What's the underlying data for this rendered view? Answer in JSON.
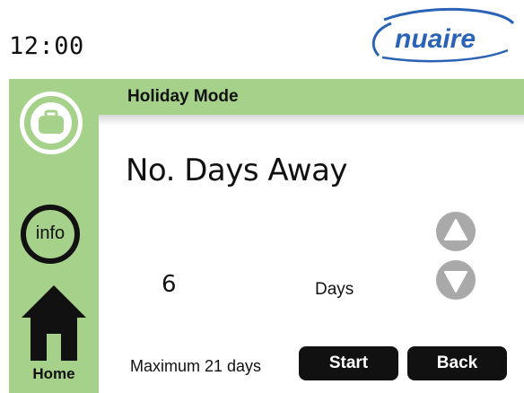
{
  "status_bar": {
    "time": "12:00",
    "logo_text": "nuaire"
  },
  "sidebar": {
    "items": [
      {
        "label": "",
        "icon": "suitcase-icon",
        "active": true
      },
      {
        "label": "info",
        "icon": "info-icon"
      },
      {
        "label": "Home",
        "icon": "home-icon"
      }
    ]
  },
  "header": {
    "title": "Holiday Mode"
  },
  "main": {
    "heading": "No. Days Away",
    "days_value": "6",
    "days_unit": "Days",
    "max_note": "Maximum 21 days",
    "increase_icon": "triangle-up-icon",
    "decrease_icon": "triangle-down-icon"
  },
  "actions": {
    "start_label": "Start",
    "back_label": "Back"
  },
  "colors": {
    "accent_green": "#a5d18a",
    "button_black": "#111111",
    "arrow_gray": "#a9a9a9",
    "logo_blue": "#2a62b5"
  }
}
